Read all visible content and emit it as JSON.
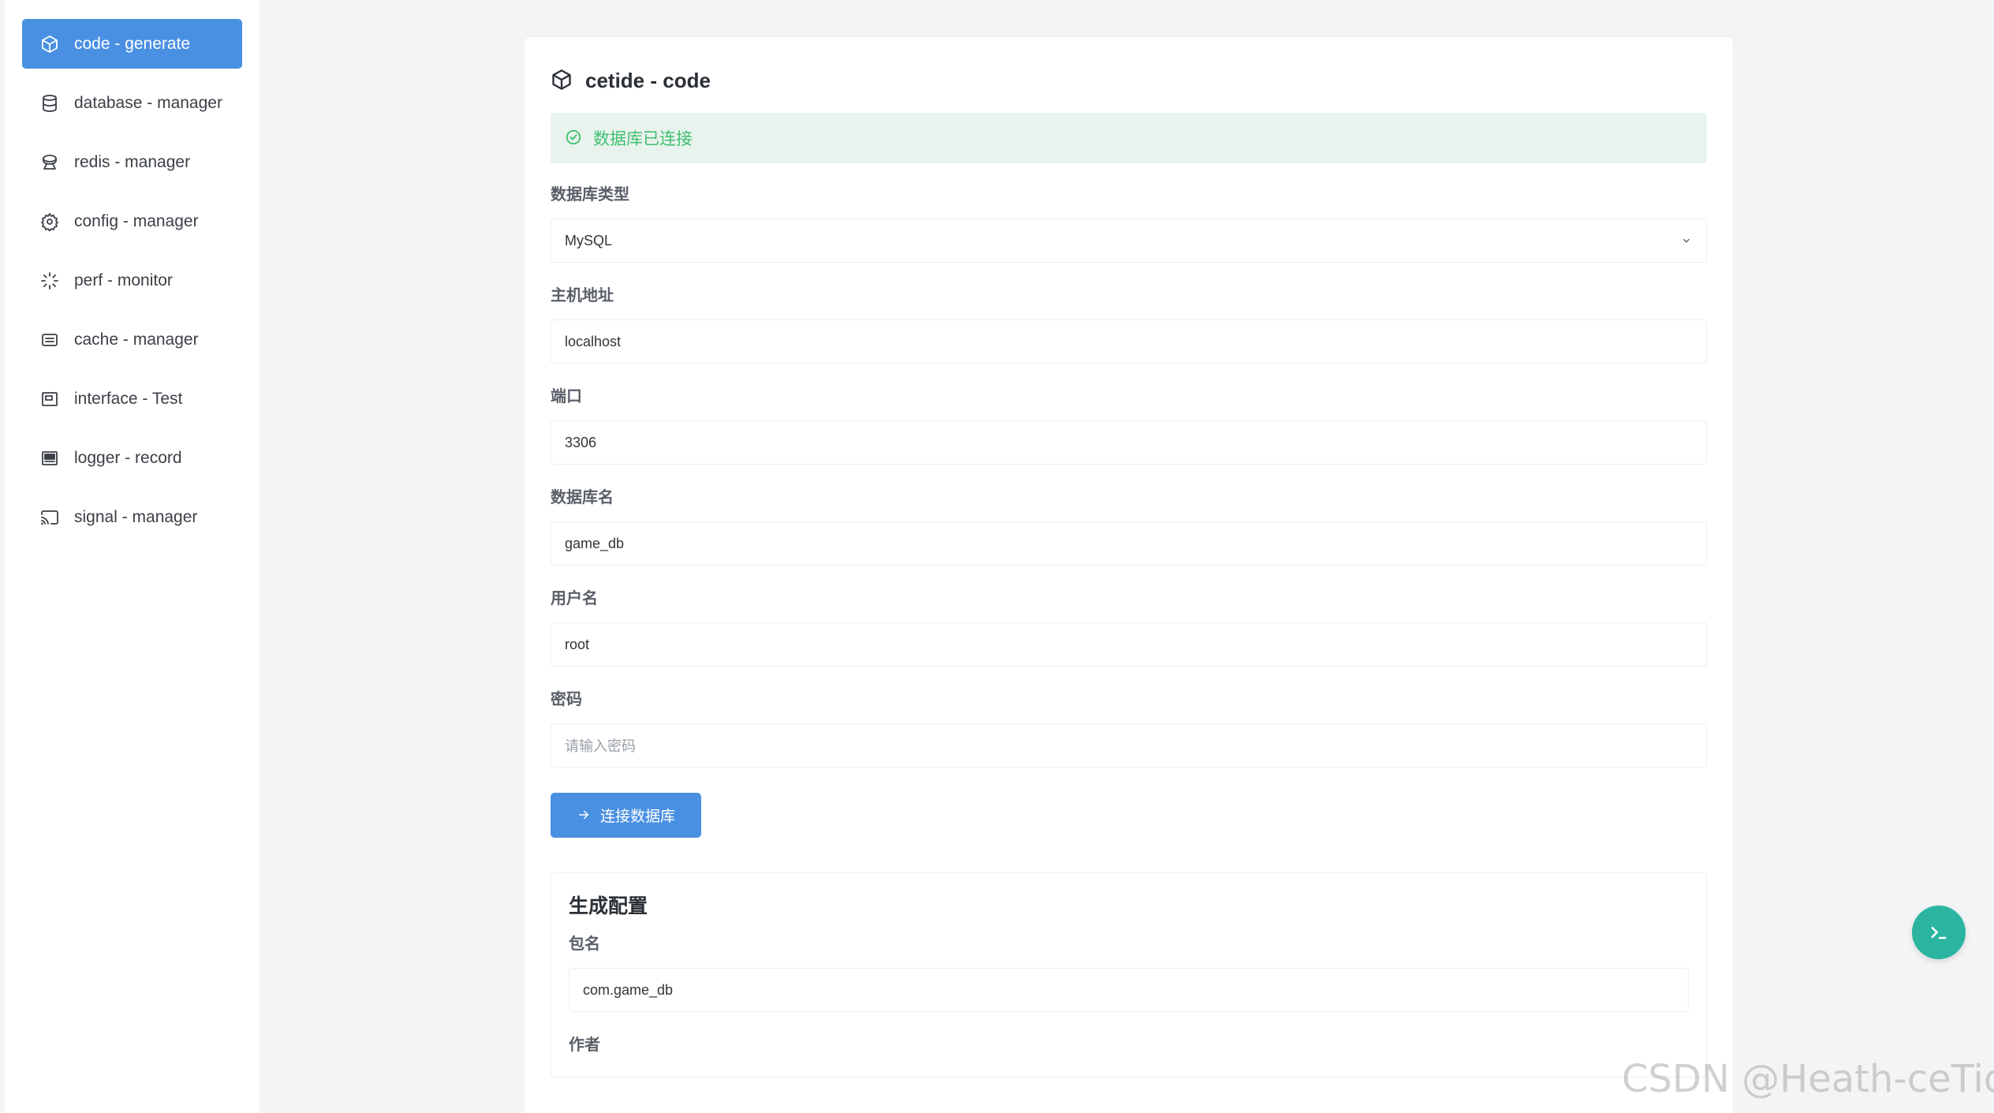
{
  "sidebar": {
    "items": [
      {
        "label": "code - generate",
        "icon": "cube-icon",
        "active": true
      },
      {
        "label": "database - manager",
        "icon": "database-icon"
      },
      {
        "label": "redis - manager",
        "icon": "layers-icon"
      },
      {
        "label": "config - manager",
        "icon": "gear-icon"
      },
      {
        "label": "perf - monitor",
        "icon": "loader-icon"
      },
      {
        "label": "cache - manager",
        "icon": "cache-icon"
      },
      {
        "label": "interface - Test",
        "icon": "window-icon"
      },
      {
        "label": "logger - record",
        "icon": "log-icon"
      },
      {
        "label": "signal - manager",
        "icon": "cast-icon"
      }
    ]
  },
  "card": {
    "title": "cetide - code",
    "alert": "数据库已连接",
    "fields": {
      "db_type": {
        "label": "数据库类型",
        "value": "MySQL"
      },
      "host": {
        "label": "主机地址",
        "value": "localhost"
      },
      "port": {
        "label": "端口",
        "value": "3306"
      },
      "db_name": {
        "label": "数据库名",
        "value": "game_db"
      },
      "username": {
        "label": "用户名",
        "value": "root"
      },
      "password": {
        "label": "密码",
        "placeholder": "请输入密码"
      }
    },
    "connect_button": "连接数据库",
    "gen_config": {
      "title": "生成配置",
      "package_label": "包名",
      "package_value": "com.game_db",
      "author_label": "作者"
    }
  },
  "watermark": "CSDN @Heath-ceTide",
  "colors": {
    "accent": "#4a90e2",
    "success": "#3fbf6e",
    "fab": "#2bb5a0"
  }
}
